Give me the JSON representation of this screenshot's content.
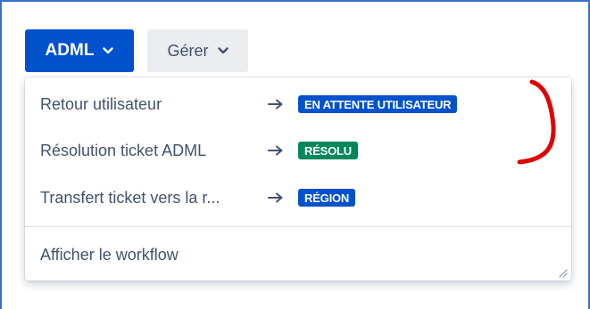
{
  "toolbar": {
    "primary_label": "ADML",
    "secondary_label": "Gérer"
  },
  "dropdown": {
    "items": [
      {
        "label": "Retour utilisateur",
        "status": "EN ATTENTE UTILISATEUR",
        "status_color": "#0052cc"
      },
      {
        "label": "Résolution ticket ADML",
        "status": "RÉSOLU",
        "status_color": "#00875a"
      },
      {
        "label": "Transfert ticket vers la r...",
        "status": "RÉGION",
        "status_color": "#0052cc"
      }
    ],
    "footer_label": "Afficher le workflow"
  },
  "colors": {
    "primary_button": "#0052cc",
    "secondary_button": "#ebecf0",
    "annotation": "#e00000"
  },
  "icons": {
    "dropdown_chevron": "chevron-down-icon",
    "transition_arrow": "arrow-right-icon",
    "resize": "resize-handle-icon"
  }
}
